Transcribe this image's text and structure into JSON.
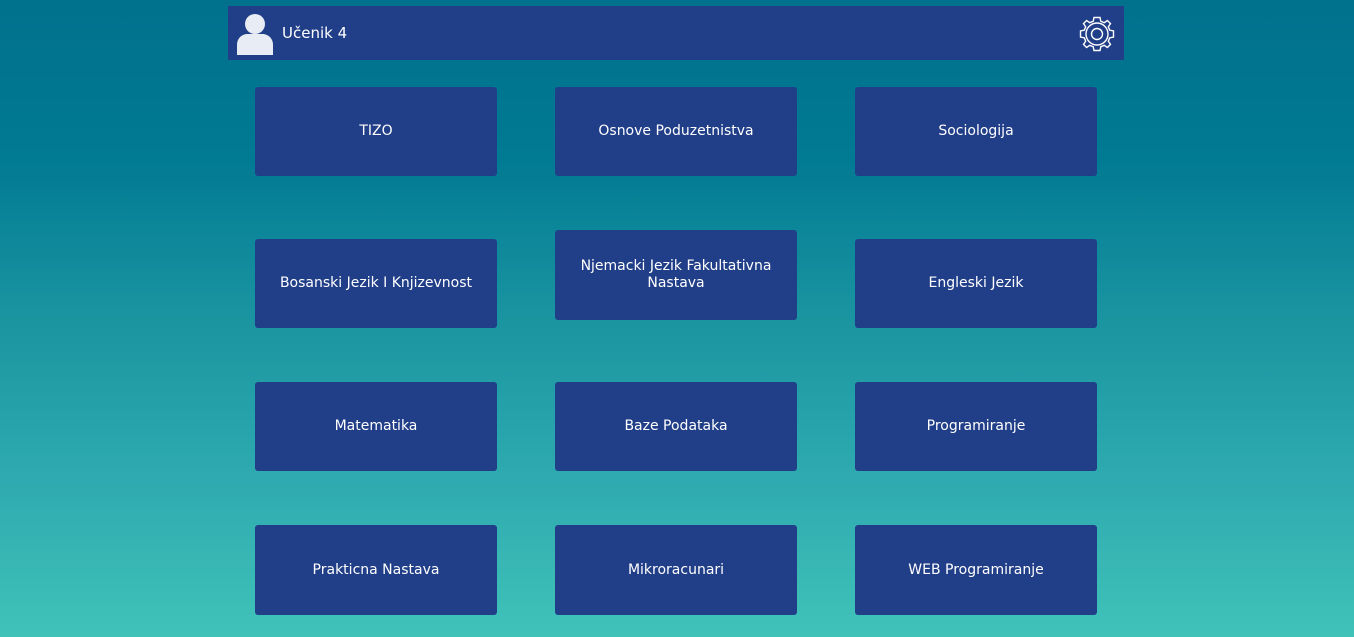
{
  "header": {
    "username": "Učenik 4",
    "avatar_icon": "user-icon",
    "settings_icon": "gear-icon"
  },
  "colors": {
    "header_bg": "#213e88",
    "tile_bg": "#213e88",
    "background_top": "#01718e",
    "background_bottom": "#40c2b8",
    "text": "#ffffff"
  },
  "subjects": [
    {
      "label": "TIZO"
    },
    {
      "label": "Osnove Poduzetnistva"
    },
    {
      "label": "Sociologija"
    },
    {
      "label": "Bosanski Jezik I Knjizevnost"
    },
    {
      "label": "Njemacki Jezik Fakultativna Nastava"
    },
    {
      "label": "Engleski Jezik"
    },
    {
      "label": "Matematika"
    },
    {
      "label": "Baze Podataka"
    },
    {
      "label": "Programiranje"
    },
    {
      "label": "Prakticna Nastava"
    },
    {
      "label": "Mikroracunari"
    },
    {
      "label": "WEB Programiranje"
    }
  ]
}
